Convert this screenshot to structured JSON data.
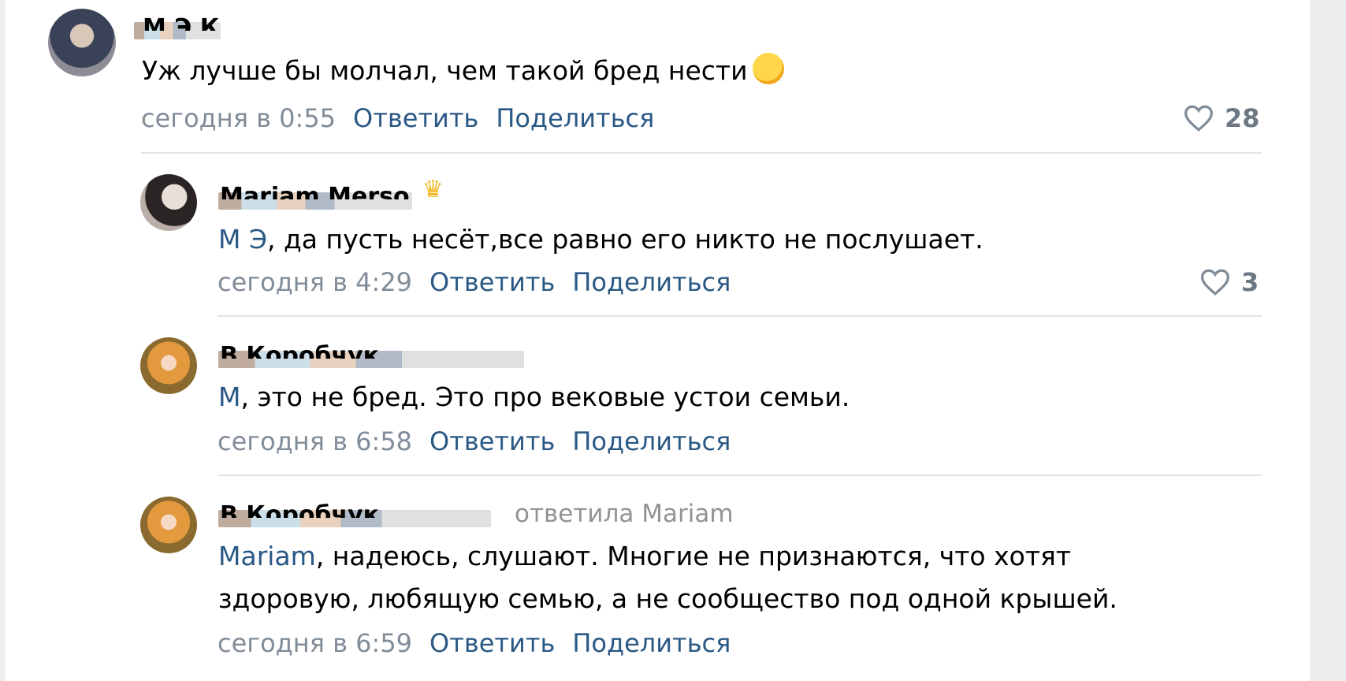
{
  "comments": [
    {
      "author": "М Э К",
      "text": "Уж лучше бы молчал, чем такой бред нести",
      "emoji_icon": "kissing-face-emoji",
      "date": "сегодня в 0:55",
      "reply_label": "Ответить",
      "share_label": "Поделиться",
      "likes": "28"
    },
    {
      "author": "Mariam Merso",
      "badge_icon": "crown-icon",
      "mention": "М Э",
      "text": ", да пусть несёт,все равно его никто не послушает.",
      "date": "сегодня в 4:29",
      "reply_label": "Ответить",
      "share_label": "Поделиться",
      "likes": "3"
    },
    {
      "author": "В Коробчук",
      "mention": "М",
      "text": ", это не бред. Это про вековые устои семьи.",
      "date": "сегодня в 6:58",
      "reply_label": "Ответить",
      "share_label": "Поделиться"
    },
    {
      "author": "В Коробчук",
      "replied_to": "ответила Mariam",
      "mention": "Mariam",
      "text_line1": ", надеюсь, слушают. Многие не признаются, что хотят",
      "text_line2": "здоровую, любящую семью, а не сообщество под одной крышей.",
      "date": "сегодня в 6:59",
      "reply_label": "Ответить",
      "share_label": "Поделиться"
    }
  ],
  "colors": {
    "link": "#2a5885",
    "meta": "#818c99",
    "divider": "#e1e3e6",
    "background": "#ffffff",
    "gutter": "#edeef0"
  }
}
